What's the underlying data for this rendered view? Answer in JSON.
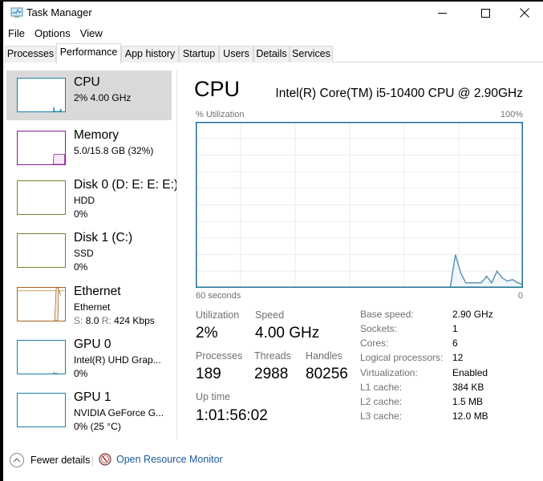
{
  "window": {
    "title": "Task Manager",
    "icons": {
      "app": "task-manager-icon",
      "minimize": "minimize-icon",
      "maximize": "maximize-icon",
      "close": "close-icon"
    }
  },
  "menu": [
    "File",
    "Options",
    "View"
  ],
  "tabs": [
    {
      "label": "Processes",
      "active": false
    },
    {
      "label": "Performance",
      "active": true
    },
    {
      "label": "App history",
      "active": false
    },
    {
      "label": "Startup",
      "active": false
    },
    {
      "label": "Users",
      "active": false
    },
    {
      "label": "Details",
      "active": false
    },
    {
      "label": "Services",
      "active": false
    }
  ],
  "sidebar": {
    "items": [
      {
        "title": "CPU",
        "line1": "2% 4.00 GHz",
        "line2": "",
        "color": "#1c7ea6",
        "selected": true
      },
      {
        "title": "Memory",
        "line1": "5.0/15.8 GB (32%)",
        "line2": "",
        "color": "#8b1a99",
        "selected": false
      },
      {
        "title": "Disk 0 (D: E: E: E:)",
        "line1": "HDD",
        "line2": "0%",
        "color": "#6a8a2a",
        "selected": false
      },
      {
        "title": "Disk 1 (C:)",
        "line1": "SSD",
        "line2": "0%",
        "color": "#6a8a2a",
        "selected": false
      },
      {
        "title": "Ethernet",
        "line1": "Ethernet",
        "line2_send_label": "S:",
        "line2_send": "8.0",
        "line2_recv_label": "R:",
        "line2_recv": "424 Kbps",
        "color": "#a7631c",
        "selected": false
      },
      {
        "title": "GPU 0",
        "line1": "Intel(R) UHD Grap...",
        "line2": "0%",
        "color": "#1c7ea6",
        "selected": false
      },
      {
        "title": "GPU 1",
        "line1": "NVIDIA GeForce G...",
        "line2": "0% (25 °C)",
        "color": "#1c7ea6",
        "selected": false
      }
    ]
  },
  "main": {
    "title": "CPU",
    "model": "Intel(R) Core(TM) i5-10400 CPU @ 2.90GHz",
    "graph": {
      "y_label": "% Utilization",
      "y_max_label": "100%",
      "x_left_label": "60 seconds",
      "x_right_label": "0",
      "line_color": "#5f94b5",
      "fill_color": "#f1f7fb",
      "border_color": "#1c6f8f",
      "samples_pct": [
        0,
        0,
        0,
        0,
        0,
        0,
        0,
        0,
        0,
        0,
        0,
        0,
        0,
        0,
        0,
        0,
        0,
        0,
        0,
        0,
        0,
        0,
        0,
        0,
        0,
        0,
        0,
        0,
        0,
        0,
        0,
        0,
        0,
        0,
        0,
        0,
        0,
        0,
        0,
        0,
        0,
        0,
        0,
        0,
        0,
        0,
        0,
        0,
        0,
        0,
        20,
        9,
        3,
        3,
        3,
        3,
        7,
        3,
        10,
        6,
        4,
        5,
        3,
        2
      ]
    },
    "stats": {
      "utilization": {
        "label": "Utilization",
        "value": "2%"
      },
      "speed": {
        "label": "Speed",
        "value": "4.00 GHz"
      },
      "processes": {
        "label": "Processes",
        "value": "189"
      },
      "threads": {
        "label": "Threads",
        "value": "2988"
      },
      "handles": {
        "label": "Handles",
        "value": "80256"
      },
      "uptime": {
        "label": "Up time",
        "value": "1:01:56:02"
      }
    },
    "details": [
      {
        "label": "Base speed:",
        "value": "2.90 GHz"
      },
      {
        "label": "Sockets:",
        "value": "1"
      },
      {
        "label": "Cores:",
        "value": "6"
      },
      {
        "label": "Logical processors:",
        "value": "12"
      },
      {
        "label": "Virtualization:",
        "value": "Enabled"
      },
      {
        "label": "L1 cache:",
        "value": "384 KB"
      },
      {
        "label": "L2 cache:",
        "value": "1.5 MB"
      },
      {
        "label": "L3 cache:",
        "value": "12.0 MB"
      }
    ]
  },
  "footer": {
    "fewer_details": "Fewer details",
    "open_resource_monitor": "Open Resource Monitor"
  }
}
